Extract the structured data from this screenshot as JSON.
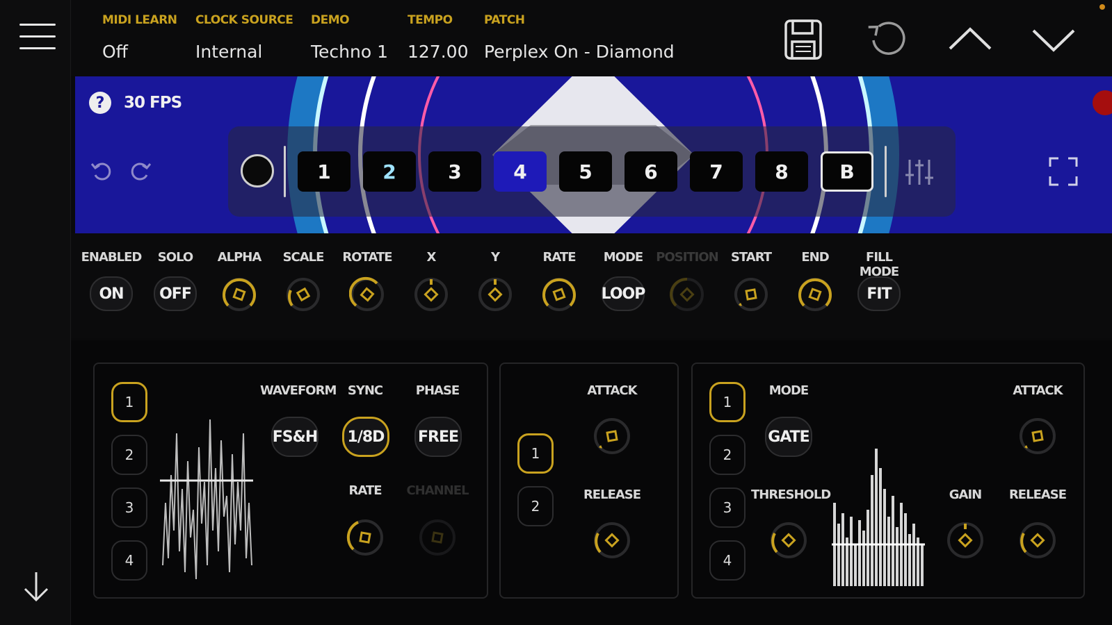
{
  "colors": {
    "accent": "#c9a21f",
    "visual_bg": "#19179a",
    "selected_layer": "#1e1ab8",
    "record": "#a50e0e"
  },
  "topbar": {
    "fields": [
      {
        "label": "MIDI LEARN",
        "value": "Off"
      },
      {
        "label": "CLOCK SOURCE",
        "value": "Internal"
      },
      {
        "label": "DEMO",
        "value": "Techno 1"
      },
      {
        "label": "TEMPO",
        "value": "127.00"
      },
      {
        "label": "PATCH",
        "value": "Perplex On - Diamond"
      }
    ],
    "icons": [
      "save-icon",
      "revert-icon",
      "chevron-up-icon",
      "chevron-down-icon"
    ]
  },
  "visual": {
    "fps": "30 FPS",
    "layers": [
      "1",
      "2",
      "3",
      "4",
      "5",
      "6",
      "7",
      "8",
      "B"
    ],
    "selected_layer": "4"
  },
  "controls": [
    {
      "label": "ENABLED",
      "kind": "pill",
      "value": "ON"
    },
    {
      "label": "SOLO",
      "kind": "pill",
      "value": "OFF"
    },
    {
      "label": "ALPHA",
      "kind": "knob"
    },
    {
      "label": "SCALE",
      "kind": "knob"
    },
    {
      "label": "ROTATE",
      "kind": "knob"
    },
    {
      "label": "X",
      "kind": "knob"
    },
    {
      "label": "Y",
      "kind": "knob"
    },
    {
      "label": "RATE",
      "kind": "knob"
    },
    {
      "label": "MODE",
      "kind": "pill",
      "value": "LOOP"
    },
    {
      "label": "POSITION",
      "kind": "knob",
      "disabled": true
    },
    {
      "label": "START",
      "kind": "knob"
    },
    {
      "label": "END",
      "kind": "knob"
    },
    {
      "label": "FILL MODE",
      "kind": "pill",
      "value": "FIT"
    }
  ],
  "lfo_panel": {
    "numbers": [
      "1",
      "2",
      "3",
      "4"
    ],
    "waveform_label": "WAVEFORM",
    "waveform_value": "FS&H",
    "sync_label": "SYNC",
    "sync_value": "1/8D",
    "phase_label": "PHASE",
    "phase_value": "FREE",
    "rate_label": "RATE",
    "channel_label": "CHANNEL"
  },
  "env_panel": {
    "numbers": [
      "1",
      "2"
    ],
    "attack_label": "ATTACK",
    "release_label": "RELEASE"
  },
  "audio_panel": {
    "numbers": [
      "1",
      "2",
      "3",
      "4"
    ],
    "mode_label": "MODE",
    "mode_value": "GATE",
    "threshold_label": "THRESHOLD",
    "gain_label": "GAIN",
    "attack_label": "ATTACK",
    "release_label": "RELEASE"
  }
}
